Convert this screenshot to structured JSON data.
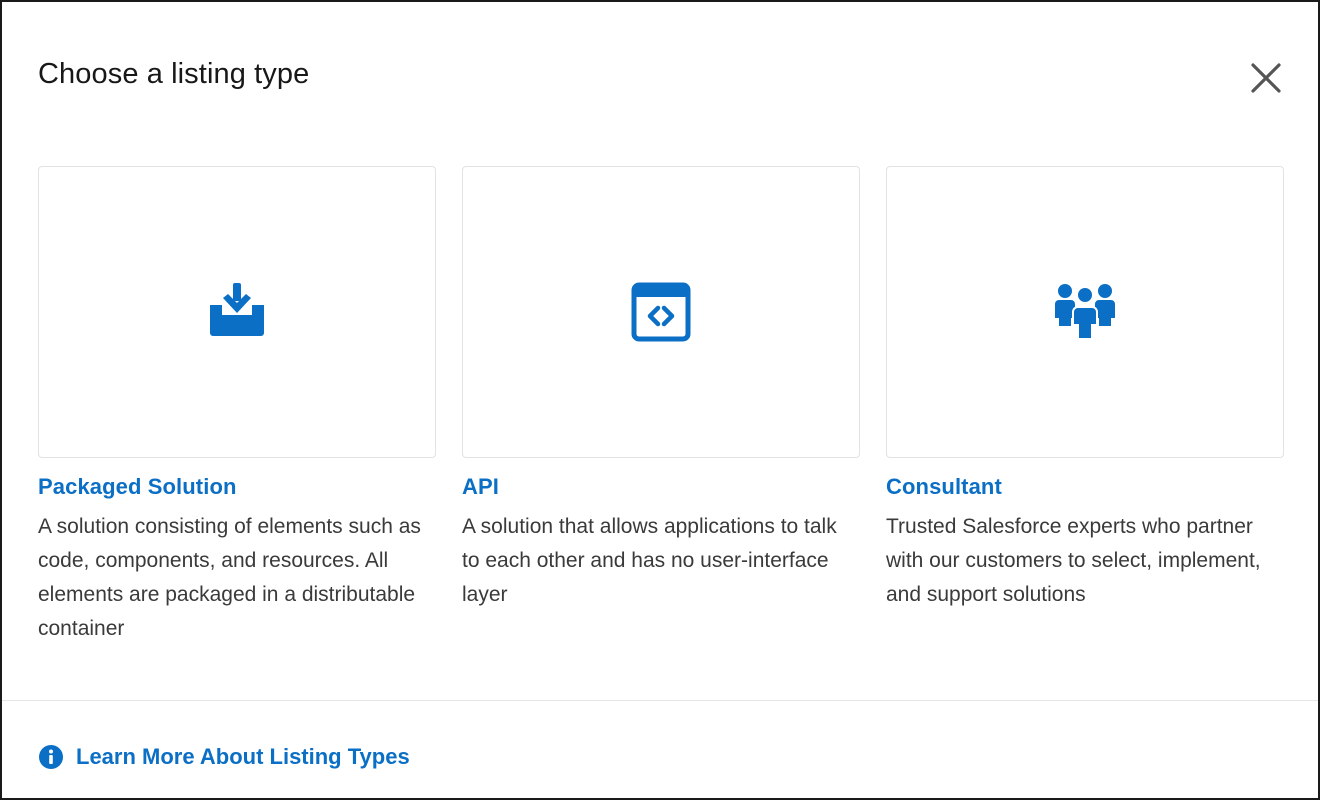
{
  "modal": {
    "title": "Choose a listing type",
    "close_icon": "close-icon",
    "accent_color": "#0b6fc6"
  },
  "cards": [
    {
      "icon": "download-tray-icon",
      "title": "Packaged Solution",
      "description": "A solution consisting of elements such as code, components, and resources. All elements are packaged in a distributable container"
    },
    {
      "icon": "code-window-icon",
      "title": "API",
      "description": "A solution that allows applications to talk to each other and has no user-interface layer"
    },
    {
      "icon": "people-group-icon",
      "title": "Consultant",
      "description": "Trusted Salesforce experts who partner with our customers to select, implement, and support solutions"
    }
  ],
  "footer": {
    "link_icon": "info-icon",
    "link_label": "Learn More About Listing Types"
  }
}
